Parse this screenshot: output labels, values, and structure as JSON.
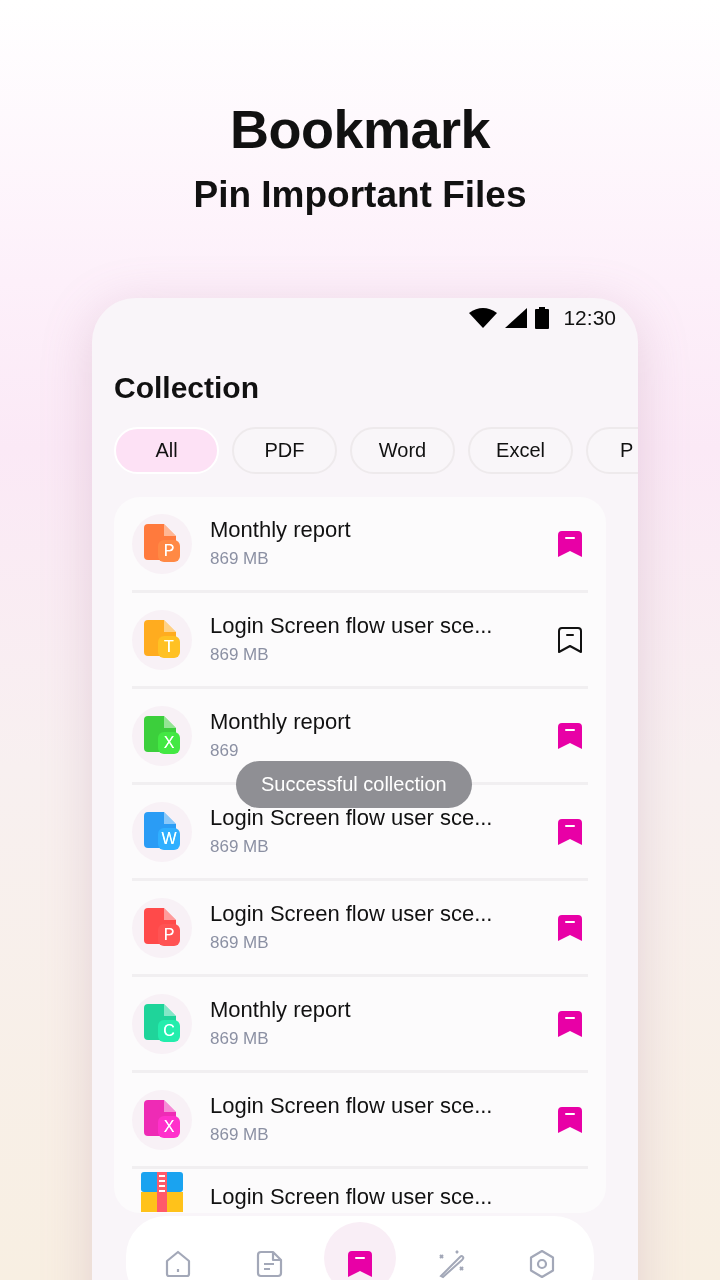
{
  "headline": "Bookmark",
  "subtitle": "Pin Important Files",
  "status_bar": {
    "time": "12:30"
  },
  "title": "Collection",
  "filters": [
    {
      "label": "All",
      "selected": true
    },
    {
      "label": "PDF",
      "selected": false
    },
    {
      "label": "Word",
      "selected": false
    },
    {
      "label": "Excel",
      "selected": false
    },
    {
      "label": "P",
      "selected": false
    }
  ],
  "files": [
    {
      "kind": "doc",
      "color": "#ff7a3d",
      "badge": "P",
      "title": "Monthly report",
      "size": "869 MB",
      "bookmarked": true
    },
    {
      "kind": "doc",
      "color": "#ffac1f",
      "badge": "T",
      "title": "Login Screen flow user sce...",
      "size": "869 MB",
      "bookmarked": false
    },
    {
      "kind": "doc",
      "color": "#3ccf3c",
      "badge": "X",
      "title": "Monthly report",
      "size": "869",
      "bookmarked": true
    },
    {
      "kind": "doc",
      "color": "#2a9cf5",
      "badge": "W",
      "title": "Login Screen flow user sce...",
      "size": "869 MB",
      "bookmarked": true
    },
    {
      "kind": "doc",
      "color": "#ff4a4a",
      "badge": "P",
      "title": "Login Screen flow user sce...",
      "size": "869 MB",
      "bookmarked": true
    },
    {
      "kind": "doc",
      "color": "#1fd49a",
      "badge": "C",
      "title": "Monthly report",
      "size": "869 MB",
      "bookmarked": true
    },
    {
      "kind": "doc",
      "color": "#ee2bb5",
      "badge": "X",
      "title": "Login Screen flow user sce...",
      "size": "869 MB",
      "bookmarked": true
    },
    {
      "kind": "zip",
      "title": "Login Screen flow user sce..."
    }
  ],
  "toast": "Successful collection",
  "nav": [
    {
      "kind": "home",
      "selected": false
    },
    {
      "kind": "document",
      "selected": false
    },
    {
      "kind": "bookmark",
      "selected": true
    },
    {
      "kind": "wand",
      "selected": false
    },
    {
      "kind": "settings",
      "selected": false
    }
  ]
}
